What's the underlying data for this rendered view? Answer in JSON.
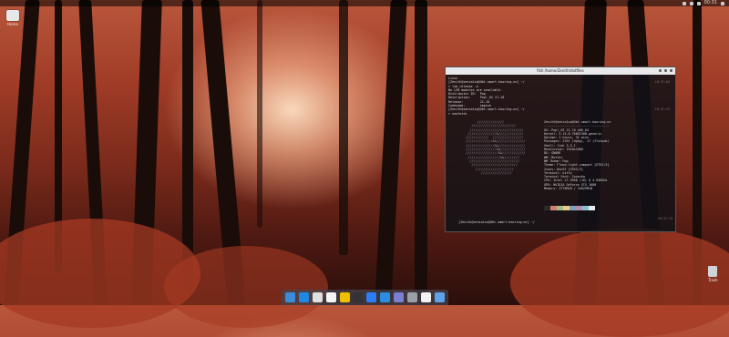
{
  "topbar": {
    "apps_label": "",
    "clock": "00:31"
  },
  "desktop": {
    "home_icon": {
      "label": "Home",
      "icon": "folder-icon"
    },
    "trash_icon": {
      "label": "Trash",
      "icon": "trash-icon"
    }
  },
  "terminal": {
    "title": "fish /home/Zenith/dotfiles",
    "lines": [
      {
        "text": "Linux",
        "time": ""
      },
      {
        "text": "[Zenith@zenia1xo@Ubt-smart-hooring-mr] ~/",
        "time": "10:37:04"
      },
      {
        "text": "> lsb_release -a",
        "time": ""
      },
      {
        "text": "No LSB modules are available.",
        "time": ""
      },
      {
        "text": "Distributor ID:  Pop",
        "time": ""
      },
      {
        "text": "Description:     Pop!_OS 21.10",
        "time": ""
      },
      {
        "text": "Release:         21.10",
        "time": ""
      },
      {
        "text": "Codename:        impish",
        "time": ""
      },
      {
        "text": "[Zenith@zenia1xo@Ubt-smart-hooring-mr] ~/",
        "time": "10:37:12"
      },
      {
        "text": "> neofetch",
        "time": ""
      }
    ],
    "neofetch_info": [
      "Zenith@zenia1xo@Ubt-smart-hooring-mr",
      "-----------------------------------",
      "OS: Pop!_OS 21.10 x86_64",
      "Kernel: 5.15.8-76051508-generic",
      "Uptime: 1 hours, 31 mins",
      "Packages: 2251 (dpkg), 17 (flatpak)",
      "Shell: fish 3.3.1",
      "Resolution: 1920x1080",
      "DE: GNOME",
      "WM: Mutter",
      "WM Theme: Pop",
      "Theme: Flood-light-compact [GTK2/3]",
      "Icons: WinSF [GTK2/3]",
      "Terminal: kitty",
      "Terminal Font: Iosevka",
      "CPU: Intel i7-9568 (16) @ 4.900GHz",
      "GPU: NVIDIA GeForce GTX 1080",
      "Memory: 3776MiB / 16029MiB"
    ],
    "final_prompt": "[Zenith@zenia1xo@Ubt-smart-hooring-mr] ~/",
    "final_time": "10:37:15",
    "swatch_colors": [
      "#2b2b2b",
      "#d08070",
      "#a3be8c",
      "#ebcb8b",
      "#81a1c1",
      "#b48ead",
      "#88c0d0",
      "#e5e9f0"
    ]
  },
  "dock": {
    "items": [
      {
        "name": "files-icon",
        "color": "#3c8bd9"
      },
      {
        "name": "browser-icon",
        "color": "#1e88e5"
      },
      {
        "name": "mail-icon",
        "color": "#e0e0e0"
      },
      {
        "name": "calendar-icon",
        "color": "#f5f5f5"
      },
      {
        "name": "folder-icon",
        "color": "#f0c000"
      },
      {
        "name": "text-editor-icon",
        "color": "#333333"
      },
      {
        "name": "appstore-icon",
        "color": "#2d7df6"
      },
      {
        "name": "vscode-icon",
        "color": "#2b8de0"
      },
      {
        "name": "music-icon",
        "color": "#7b7fd1"
      },
      {
        "name": "settings-icon",
        "color": "#9aa0a6"
      },
      {
        "name": "terminal-icon",
        "color": "#f2f2f2"
      },
      {
        "name": "image-viewer-icon",
        "color": "#5ea3e8"
      }
    ]
  }
}
